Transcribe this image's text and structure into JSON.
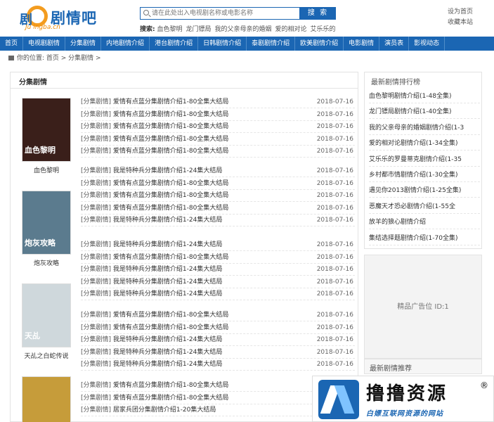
{
  "header": {
    "logo_text": "剧情吧",
    "logo_sub": "Ju  ingba.cn",
    "logo_mark": "剧",
    "search_placeholder": "请在此处出入电视剧名称或电影名称",
    "search_button": "搜 索",
    "hot_label": "搜索:",
    "hot_items": [
      "血色黎明",
      "龙门镖局",
      "我的父亲母亲的婚姻",
      "爱的相对论",
      "艾乐乐的"
    ],
    "top_links": [
      "设为首页",
      "收藏本站"
    ]
  },
  "nav": [
    "首页",
    "电视剧剧情",
    "分集剧情",
    "内地剧情介绍",
    "港台剧情介绍",
    "日韩剧情介绍",
    "泰剧剧情介绍",
    "欧美剧情介绍",
    "电影剧情",
    "演员表",
    "影视动态"
  ],
  "breadcrumb": {
    "label": "你的位置:",
    "path": "首页 > 分集剧情 >"
  },
  "main": {
    "title": "分集剧情",
    "posters": [
      {
        "name": "血色黎明",
        "poster_text": "血色黎明",
        "color": "#3a1f1a"
      },
      {
        "name": "炮灰攻略",
        "poster_text": "炮灰攻略",
        "color": "#5b7b8e"
      },
      {
        "name": "天乩之白蛇传说",
        "poster_text": "天乩",
        "color": "#cfd8dc"
      },
      {
        "name": "",
        "poster_text": "",
        "color": "#c69c3a"
      }
    ],
    "rows": [
      {
        "tag": "[分集剧情]",
        "title": "爱情有点蓝分集剧情介绍1-80全集大结局",
        "date": "2018-07-16"
      },
      {
        "tag": "[分集剧情]",
        "title": "爱情有点蓝分集剧情介绍1-80全集大结局",
        "date": "2018-07-16"
      },
      {
        "tag": "[分集剧情]",
        "title": "爱情有点蓝分集剧情介绍1-80全集大结局",
        "date": "2018-07-16"
      },
      {
        "tag": "[分集剧情]",
        "title": "爱情有点蓝分集剧情介绍1-80全集大结局",
        "date": "2018-07-16"
      },
      {
        "tag": "[分集剧情]",
        "title": "爱情有点蓝分集剧情介绍1-80全集大结局",
        "date": "2018-07-16"
      },
      {
        "tag": "[分集剧情]",
        "title": "我是特种兵分集剧情介绍1-24集大结局",
        "date": "2018-07-16"
      },
      {
        "tag": "[分集剧情]",
        "title": "爱情有点蓝分集剧情介绍1-80全集大结局",
        "date": "2018-07-16"
      },
      {
        "tag": "[分集剧情]",
        "title": "爱情有点蓝分集剧情介绍1-80全集大结局",
        "date": "2018-07-16"
      },
      {
        "tag": "[分集剧情]",
        "title": "爱情有点蓝分集剧情介绍1-80全集大结局",
        "date": "2018-07-16"
      },
      {
        "tag": "[分集剧情]",
        "title": "我是特种兵分集剧情介绍1-24集大结局",
        "date": "2018-07-16"
      },
      {
        "tag": "[分集剧情]",
        "title": "我是特种兵分集剧情介绍1-24集大结局",
        "date": "2018-07-16"
      },
      {
        "tag": "[分集剧情]",
        "title": "爱情有点蓝分集剧情介绍1-80全集大结局",
        "date": "2018-07-16"
      },
      {
        "tag": "[分集剧情]",
        "title": "我是特种兵分集剧情介绍1-24集大结局",
        "date": "2018-07-16"
      },
      {
        "tag": "[分集剧情]",
        "title": "我是特种兵分集剧情介绍1-24集大结局",
        "date": "2018-07-16"
      },
      {
        "tag": "[分集剧情]",
        "title": "我是特种兵分集剧情介绍1-24集大结局",
        "date": "2018-07-16"
      },
      {
        "tag": "[分集剧情]",
        "title": "爱情有点蓝分集剧情介绍1-80全集大结局",
        "date": "2018-07-16"
      },
      {
        "tag": "[分集剧情]",
        "title": "爱情有点蓝分集剧情介绍1-80全集大结局",
        "date": "2018-07-16"
      },
      {
        "tag": "[分集剧情]",
        "title": "我是特种兵分集剧情介绍1-24集大结局",
        "date": "2018-07-16"
      },
      {
        "tag": "[分集剧情]",
        "title": "我是特种兵分集剧情介绍1-24集大结局",
        "date": "2018-07-16"
      },
      {
        "tag": "[分集剧情]",
        "title": "我是特种兵分集剧情介绍1-24集大结局",
        "date": "2018-07-16"
      },
      {
        "tag": "[分集剧情]",
        "title": "爱情有点蓝分集剧情介绍1-80全集大结局",
        "date": ""
      },
      {
        "tag": "[分集剧情]",
        "title": "爱情有点蓝分集剧情介绍1-80全集大结局",
        "date": ""
      },
      {
        "tag": "[分集剧情]",
        "title": "居家兵团分集剧情介绍1-20集大结局",
        "date": ""
      }
    ]
  },
  "sidebar": {
    "rank_title": "最新剧情排行榜",
    "rank_items": [
      "血色黎明剧情介绍(1-48全集)",
      "龙门镖局剧情介绍(1-40全集)",
      "我的父亲母亲的婚姻剧情介绍(1-3",
      "爱的相对论剧情介绍(1-34全集)",
      "艾乐乐的罗曼蒂克剧情介绍(1-35",
      "乡村都市情剧情介绍(1-30全集)",
      "遇见你2013剧情介绍(1-25全集)",
      "恶魔天才恐必剧情介绍(1-55全",
      "放羊的狼心剧情介绍",
      "集结选择题剧情介绍(1-70全集)"
    ],
    "ad_text": "精品广告位 ID:1",
    "recommend_title": "最新剧情推荐"
  },
  "watermark": {
    "title": "撸撸资源",
    "reg": "®",
    "subtitle": "白嫖互联网资源的网站"
  }
}
